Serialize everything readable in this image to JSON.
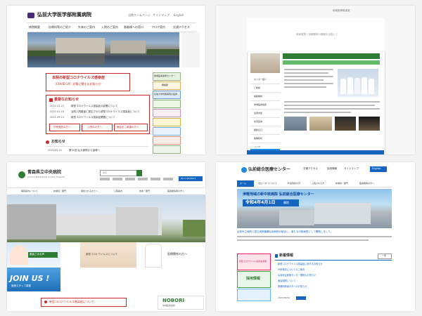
{
  "hirosaki": {
    "title": "弘前大学医学部附属病院",
    "header_links": [
      "当院ホームページ",
      "サイトマップ",
      "English"
    ],
    "nav": [
      "病院概要",
      "診療科等のご紹介",
      "外来のご案内",
      "入院のご案内",
      "患者様への窓口",
      "フロア案内",
      "交通アクセス"
    ],
    "notice_title": "本院の新型コロナウイルス感染症",
    "notice_sub": "（COVID-19）対策に関するお知らせ",
    "important_heading": "重要なお知らせ",
    "important_items": [
      {
        "date": "2022.02.21",
        "text": "新型コロナウイルス感染症の影響について"
      },
      {
        "date": "2022.01.24",
        "text": "当院入院患者に発生された新型コロナウイルス感染症について"
      },
      {
        "date": "2021.09.15",
        "text": "新型コロナウイルス感染症関連について"
      }
    ],
    "red_buttons": [
      "外来受診の方へ",
      "入院中の方へ",
      "面会をご希望の方へ"
    ],
    "news_heading": "お知らせ",
    "news_items": [
      {
        "date": "2022.02.21",
        "text": "第31回 弘大病院から皆様へ"
      }
    ],
    "sidebar_labels": [
      "地域医療連携センター",
      "看護部",
      "弘前大学附属病院の医師"
    ]
  },
  "medical_center": {
    "breadcrumb": "地域医療推進室",
    "tagline": "医療連携と信頼関係の構築を目指して",
    "menu": [
      "センター紹介",
      "ご挨拶",
      "組織構成",
      "地域医療連携",
      "患者支援",
      "在宅医療",
      "相談窓口",
      "各種様式",
      "リンク"
    ]
  },
  "aomori": {
    "title": "青森県立中央病院",
    "subtitle": "Aomori Prefectural Central Hospital",
    "search_placeholder": "検索",
    "phone": "017-726-8111",
    "nav": [
      "病院案内について",
      "診療科・部門",
      "受診されるかたへ",
      "入院案内",
      "診療・部門",
      "医療関係者の方へ"
    ],
    "banner_left": "患者さまの声",
    "banner_mid": "新型コロナウイルスについて",
    "join_us": "JOIN US !",
    "recruit_sub": "医療スタッフ募集",
    "medical_link": "医療関係の方へ",
    "covid_notice": "新型コロナウイルス感染症について",
    "noboru": "NOBORI",
    "noboru_sub": "地域医療連携"
  },
  "hirosaki_general": {
    "title": "弘前総合医療センター",
    "header_links": [
      "交通アクセス",
      "採用情報",
      "サイトマップ",
      "English"
    ],
    "nav": [
      "ホーム",
      "当センターについて",
      "外来受診の方",
      "入院される方",
      "診療科・部門",
      "医療関係の方へ"
    ],
    "hero_title": "津軽地域の新中核病院 弘前総合医療センター",
    "hero_date": "令和4年4月1日",
    "hero_date_suffix": "開院",
    "intro_text": "弘前市立病院と国立病院機構弘前病院が統合し、新たな中核病院として開院しました。",
    "news_heading": "新着情報",
    "news_items": [
      "新型コロナウイルス感染症に関するお知らせ",
      "外来受診についてのご案内",
      "弘前総合医療センター開院のお知らせ",
      "面会制限について",
      "医療関係者の方へのお知らせ"
    ],
    "side_banner_1": "新型コロナウイルス感染症情報",
    "side_banner_2": "採用情報",
    "list_link": "一覧",
    "date_stamp": "2022/04/01"
  },
  "colors": {
    "hirosaki_red": "#c62828",
    "aomori_blue": "#1565c0",
    "hirosaki_general_blue": "#1e88e5"
  }
}
